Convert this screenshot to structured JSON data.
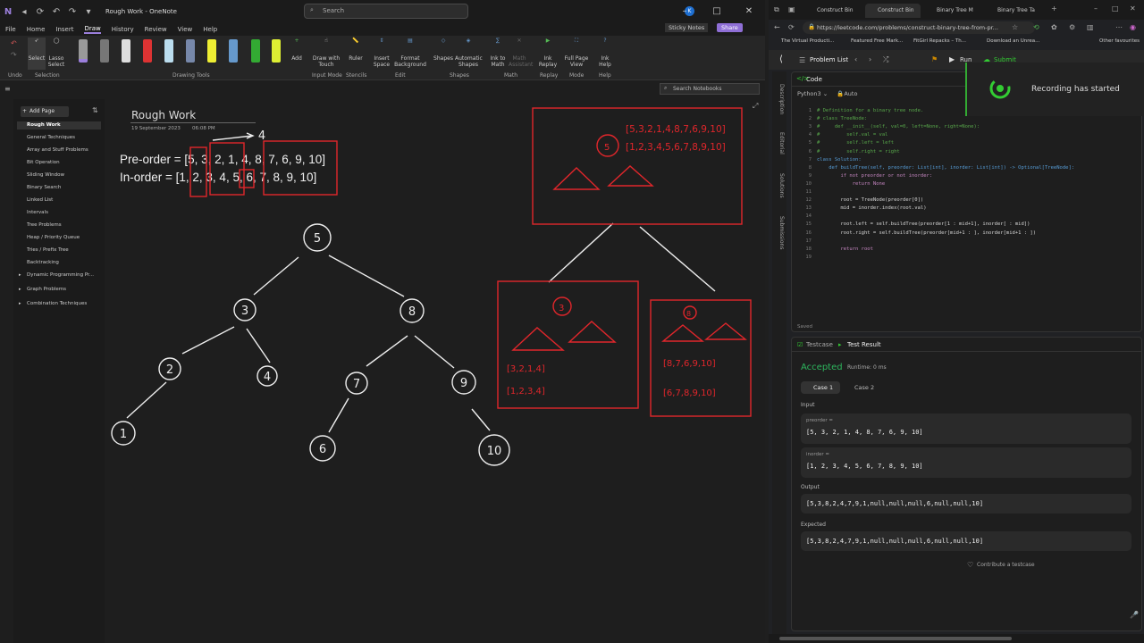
{
  "onenote": {
    "window_title": "Rough Work - OneNote",
    "search_placeholder": "Search",
    "sticky_notes": "Sticky Notes",
    "share": "Share",
    "menu": [
      "File",
      "Home",
      "Insert",
      "Draw",
      "History",
      "Review",
      "View",
      "Help"
    ],
    "ribbon": {
      "select": "Select",
      "lasso": "Lasso Select",
      "add": "Add",
      "draw_touch": "Draw with Touch",
      "ruler": "Ruler",
      "insert_space": "Insert Space",
      "format_bg": "Format Background",
      "shapes": "Shapes",
      "auto_shapes": "Automatic Shapes",
      "ink_math": "Ink to Math",
      "math_assist": "Math Assistant",
      "ink_replay": "Ink Replay",
      "full_page": "Full Page View",
      "ink_help": "Ink Help",
      "groups": [
        "Undo",
        "Selection",
        "Drawing Tools",
        "Input Mode",
        "Stencils",
        "Edit",
        "Shapes",
        "Math",
        "Replay",
        "Mode",
        "Help"
      ]
    },
    "notebook_search": "Search Notebooks",
    "add_page": "Add Page",
    "pages": [
      "Rough Work",
      "General Techniques",
      "Array and Stuff Problems",
      "Bit Operation",
      "Sliding Window",
      "Binary Search",
      "Linked List",
      "Intervals",
      "Tree Problems",
      "Heap / Priority Queue",
      "Tries / Prefix Tree",
      "Backtracking",
      "Dynamic Programming Pr...",
      "Graph Problems",
      "Combination Techniques"
    ],
    "page": {
      "title": "Rough Work",
      "date": "19 September 2023",
      "time": "06:08 PM",
      "preorder": "Pre-order = [5, 3, 2, 1, 4, 8, 7, 6, 9, 10]",
      "inorder": "In-order = [1, 2, 3, 4, 5, 6, 7, 8, 9, 10]"
    },
    "ink": {
      "arrow_label": "4",
      "tree_nodes": [
        "5",
        "3",
        "8",
        "2",
        "4",
        "7",
        "9",
        "1",
        "6",
        "10"
      ],
      "red_root": "5",
      "red_left_root": "3",
      "red_right_root": "8",
      "red_top_lists": [
        "[5,3,2,1,4,8,7,6,9,10]",
        "[1,2,3,4,5,6,7,8,9,10]"
      ],
      "red_left_lists": [
        "[3,2,1,4]",
        "[1,2,3,4]"
      ],
      "red_right_lists": [
        "[8,7,6,9,10]",
        "[6,7,8,9,10]"
      ]
    },
    "colors": {
      "ink_red": "#e0262b",
      "ink_white": "#eeeeee",
      "accent": "#9b7fdc"
    }
  },
  "browser": {
    "tabs": [
      "Construct Bin",
      "Construct Bin",
      "Binary Tree M",
      "Binary Tree Ta"
    ],
    "url": "https://leetcode.com/problems/construct-binary-tree-from-pr...",
    "bookmarks": [
      "The Virtual Producti...",
      "Featured Free Mark...",
      "FitGirl Repacks – Th...",
      "Download an Unrea...",
      "Other favourites"
    ],
    "problem_list": "Problem List",
    "run": "Run",
    "submit": "Submit",
    "recording": "Recording has started",
    "side_tabs": [
      "Description",
      "Editorial",
      "Solutions",
      "Submissions"
    ],
    "code": {
      "header": "Code",
      "language": "Python3",
      "auto": "Auto",
      "saved": "Saved",
      "lines": [
        "# Definition for a binary tree node.",
        "# class TreeNode:",
        "#     def __init__(self, val=0, left=None, right=None):",
        "#         self.val = val",
        "#         self.left = left",
        "#         self.right = right",
        "class Solution:",
        "    def buildTree(self, preorder: List[int], inorder: List[int]) -> Optional[TreeNode]:",
        "        if not preorder or not inorder:",
        "            return None",
        "",
        "        root = TreeNode(preorder[0])",
        "        mid = inorder.index(root.val)",
        "",
        "        root.left = self.buildTree(preorder[1 : mid+1], inorder[ : mid])",
        "        root.right = self.buildTree(preorder[mid+1 : ], inorder[mid+1 : ])",
        "",
        "        return root",
        ""
      ]
    },
    "result": {
      "testcase": "Testcase",
      "test_result": "Test Result",
      "status": "Accepted",
      "runtime": "Runtime: 0 ms",
      "case1": "Case 1",
      "case2": "Case 2",
      "input_label": "Input",
      "preorder_label": "preorder =",
      "preorder": "[5, 3, 2, 1, 4, 8, 7, 6, 9, 10]",
      "inorder_label": "inorder =",
      "inorder": "[1, 2, 3, 4, 5, 6, 7, 8, 9, 10]",
      "output_label": "Output",
      "output": "[5,3,8,2,4,7,9,1,null,null,null,6,null,null,10]",
      "expected_label": "Expected",
      "expected": "[5,3,8,2,4,7,9,1,null,null,null,6,null,null,10]",
      "contribute": "Contribute a testcase"
    }
  }
}
